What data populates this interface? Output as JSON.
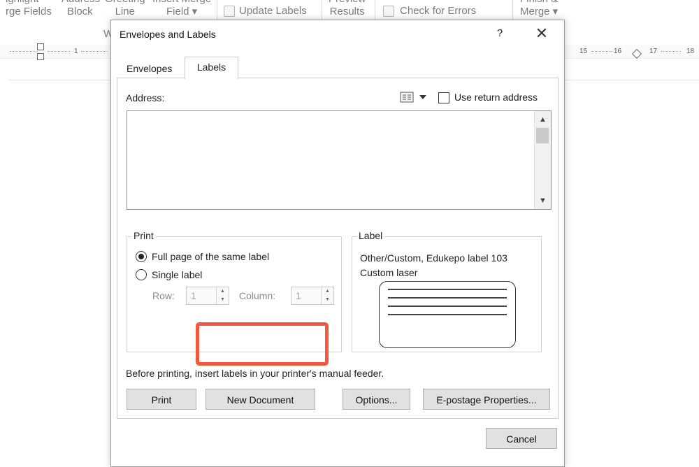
{
  "ribbon": {
    "highlight_line1": "ighlight",
    "highlight_line2": "rge Fields",
    "address_line1": "Address",
    "address_line2": "Block",
    "greeting_line1": "Greeting",
    "greeting_line2": "Line",
    "insert_line1": "Insert Merge",
    "insert_line2": "Field ▾",
    "update_labels": "Update Labels",
    "preview_line1": "Preview",
    "preview_line2": "Results",
    "check_errors": "Check for Errors",
    "finish_line1": "Finish &",
    "finish_line2": "Merge ▾",
    "write_group_fragment": "W"
  },
  "ruler": {
    "left_numbers": [
      "1"
    ],
    "right_numbers": [
      "15",
      "16",
      "17",
      "18"
    ]
  },
  "dialog": {
    "title": "Envelopes and Labels",
    "help": "?",
    "close": "✕",
    "tabs": [
      {
        "label": "Envelopes",
        "selected": false
      },
      {
        "label": "Labels",
        "selected": true
      }
    ],
    "address_label": "Address:",
    "address_value": "",
    "use_return_address": {
      "label": "Use return address",
      "checked": false
    },
    "print_group": {
      "legend": "Print",
      "options": [
        {
          "label": "Full page of the same label",
          "selected": true
        },
        {
          "label": "Single label",
          "selected": false
        }
      ],
      "row_label": "Row:",
      "row_value": "1",
      "column_label": "Column:",
      "column_value": "1"
    },
    "label_group": {
      "legend": "Label",
      "name_line1": "Other/Custom, Edukepo label 103",
      "name_line2": "Custom laser"
    },
    "note": "Before printing, insert labels in your printer's manual feeder.",
    "buttons": {
      "print": "Print",
      "new_document": "New Document",
      "options": "Options...",
      "epostage": "E-postage Properties...",
      "cancel": "Cancel"
    },
    "highlight_color": "#f05a3a"
  }
}
